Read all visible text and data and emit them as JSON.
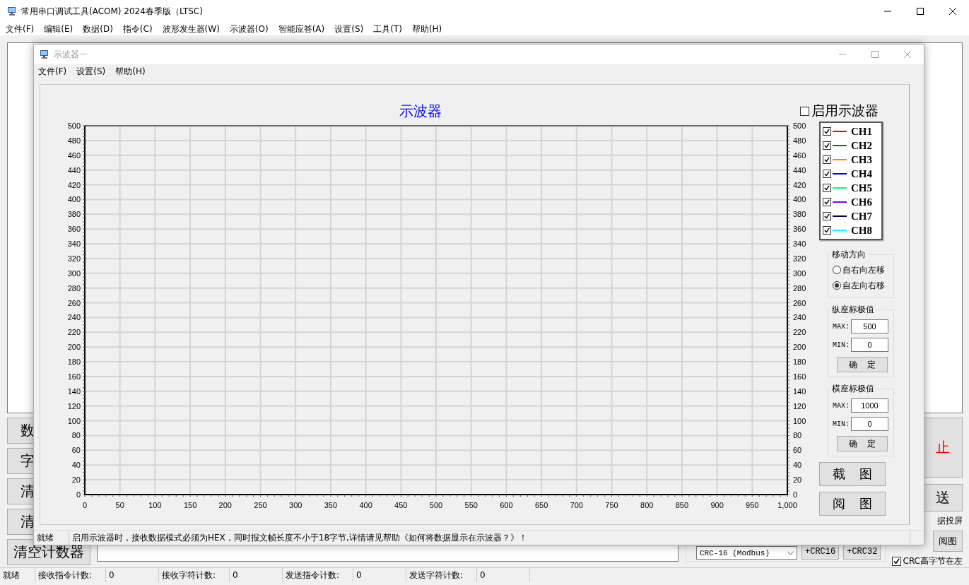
{
  "window": {
    "title": "常用串口调试工具(ACOM) 2024春季版（LTSC)"
  },
  "menu": [
    "文件(F)",
    "编辑(E)",
    "数据(D)",
    "指令(C)",
    "波形发生器(W)",
    "示波器(O)",
    "智能应答(A)",
    "设置(S)",
    "工具(T)",
    "帮助(H)"
  ],
  "left_buttons": [
    "数",
    "字",
    "清",
    "清",
    "清空计数器"
  ],
  "stop_button": "止",
  "send_button": "送",
  "projection_label": "据投屏",
  "view_button": "阅图",
  "crc_select": {
    "value": "CRC-16 (Modbus)"
  },
  "crc_buttons": [
    "+CRC16",
    "+CRC32"
  ],
  "crc_high_left": {
    "label": "CRC高字节在左",
    "checked": true
  },
  "status_bar": [
    "就绪",
    "接收指令计数:",
    "0",
    "接收字符计数:",
    "0",
    "发送指令计数:",
    "0",
    "发送字符计数:",
    "0"
  ],
  "scope": {
    "title": "示波器一",
    "menu": [
      "文件(F)",
      "设置(S)",
      "帮助(H)"
    ],
    "enable": {
      "label": "启用示波器",
      "checked": false
    },
    "chart_data": {
      "type": "line",
      "title": "示波器",
      "xlim": [
        0,
        1000
      ],
      "ylim": [
        0,
        500
      ],
      "xticks": [
        0,
        50,
        100,
        150,
        200,
        250,
        300,
        350,
        400,
        450,
        500,
        550,
        600,
        650,
        700,
        750,
        800,
        850,
        900,
        950,
        {
          "value": 1000,
          "label": "1,000"
        }
      ],
      "yticks": [
        0,
        20,
        40,
        60,
        80,
        100,
        120,
        140,
        160,
        180,
        200,
        220,
        240,
        260,
        280,
        300,
        320,
        340,
        360,
        380,
        400,
        420,
        440,
        460,
        480,
        500
      ],
      "y2ticks": [
        0,
        20,
        40,
        60,
        80,
        100,
        120,
        140,
        160,
        180,
        200,
        220,
        240,
        260,
        280,
        300,
        320,
        340,
        360,
        380,
        400,
        420,
        440,
        460,
        480,
        500
      ],
      "y2lim": [
        0,
        500
      ],
      "grid": true
    },
    "channels": [
      {
        "label": "CH1",
        "checked": true,
        "color": "#ff0000"
      },
      {
        "label": "CH2",
        "checked": true,
        "color": "#008000"
      },
      {
        "label": "CH3",
        "checked": true,
        "color": "#ff8000"
      },
      {
        "label": "CH4",
        "checked": true,
        "color": "#0000ff"
      },
      {
        "label": "CH5",
        "checked": true,
        "color": "#00ff80"
      },
      {
        "label": "CH6",
        "checked": true,
        "color": "#8000ff"
      },
      {
        "label": "CH7",
        "checked": true,
        "color": "#000040"
      },
      {
        "label": "CH8",
        "checked": true,
        "color": "#00ffff"
      }
    ],
    "direction": {
      "title": "移动方向",
      "options": [
        {
          "label": "自右向左移",
          "selected": false
        },
        {
          "label": "自左向右移",
          "selected": true
        }
      ]
    },
    "ranges": [
      {
        "title": "纵座标极值",
        "max_label": "MAX:",
        "max": "500",
        "min_label": "MIN:",
        "min": "0",
        "button": "确 定"
      },
      {
        "title": "横座标极值",
        "max_label": "MAX:",
        "max": "1000",
        "min_label": "MIN:",
        "min": "0",
        "button": "确 定"
      }
    ],
    "buttons": [
      "截 图",
      "阅 图"
    ],
    "status": [
      "就绪",
      "启用示波器时，接收数据模式必须为HEX，同时报文帧长度不小于18字节,详情请见帮助《如何将数据显示在示波器？》！"
    ]
  }
}
